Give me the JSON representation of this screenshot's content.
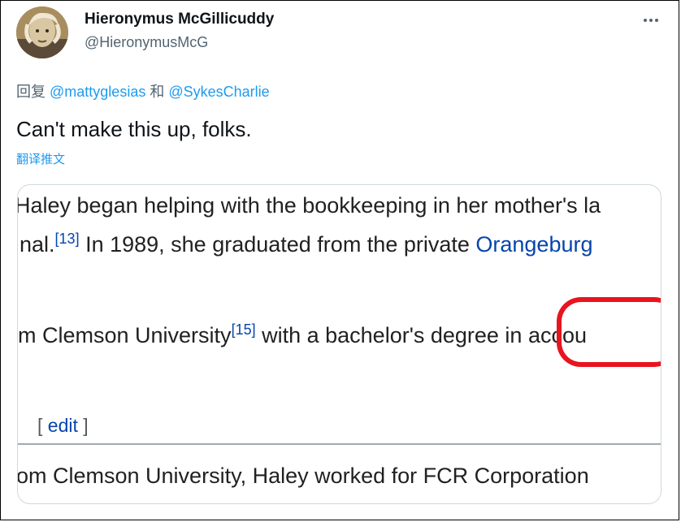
{
  "tweet": {
    "author_name": "Hieronymus McGillicuddy",
    "author_handle": "@HieronymusMcG",
    "reply": {
      "prefix": "回复",
      "mention1": "@mattyglesias",
      "conjunction": "和",
      "mention2": "@SykesCharlie"
    },
    "text": "Can't make this up, folks.",
    "translate_label": "翻译推文"
  },
  "icons": {
    "more": "more-horizontal-icon"
  },
  "screenshot_card": {
    "line1": "Haley began helping with the bookkeeping in her mother's la",
    "line2_pre": "nal.",
    "line2_ref": "[13]",
    "line2_mid": " In 1989, she graduated from the private ",
    "line2_link": "Orangeburg",
    "line3_pre": "m Clemson University",
    "line3_ref": "[15]",
    "line3_post": " with a bachelor's degree in accou",
    "edit_open": "[ ",
    "edit_label": "edit",
    "edit_close": " ]",
    "line4": "om Clemson University, Haley worked for FCR Corporation"
  },
  "colors": {
    "annotation": "#e8141f",
    "link": "#0645ad",
    "twitter_blue": "#1d9bf0"
  }
}
